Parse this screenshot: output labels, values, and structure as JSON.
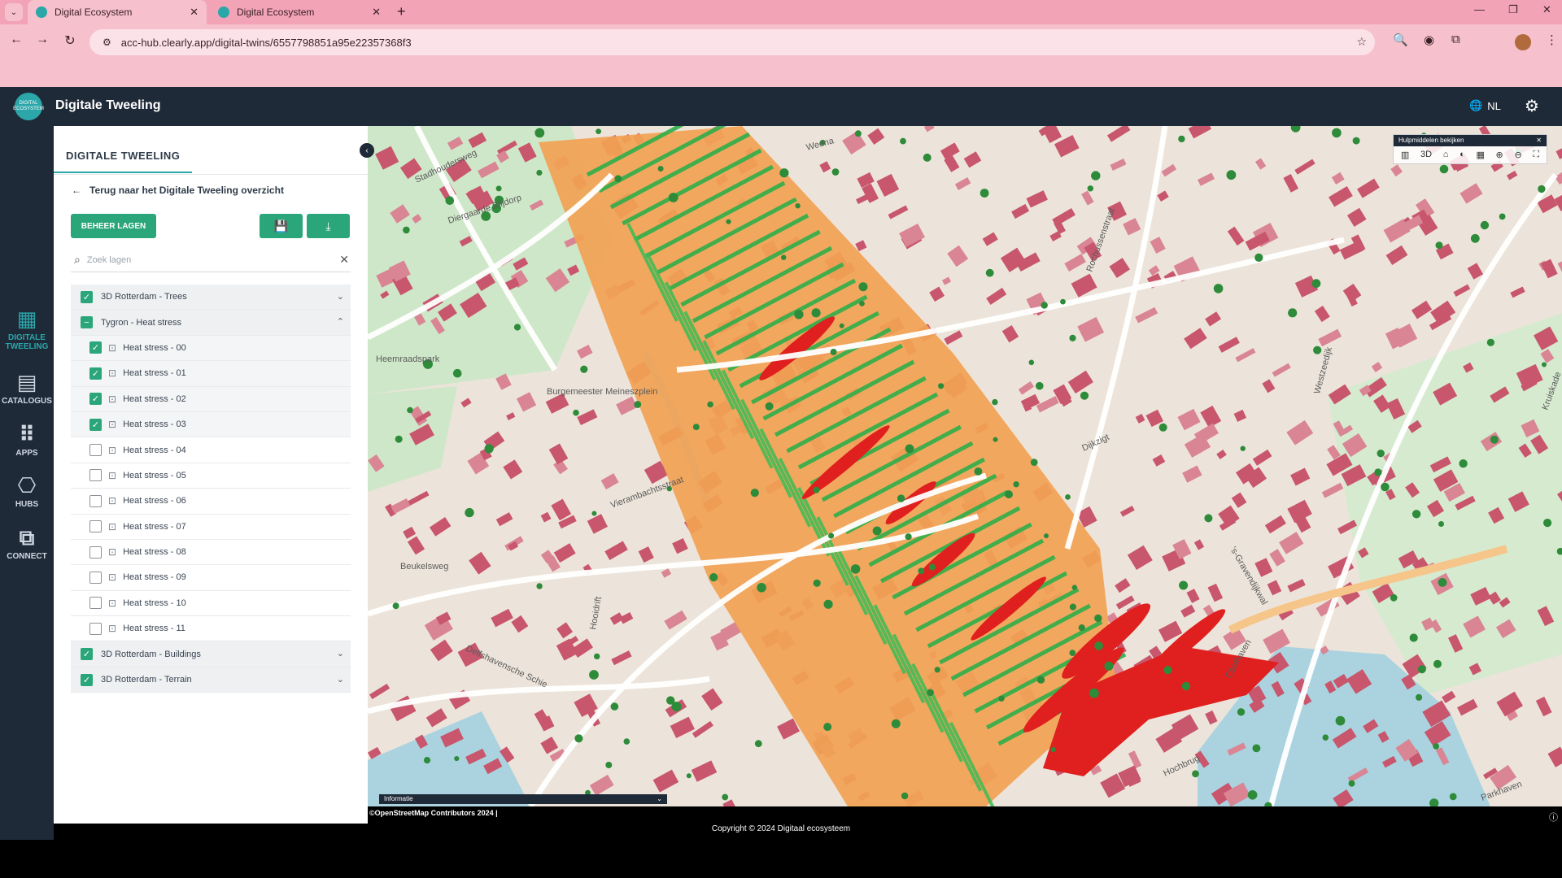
{
  "browser": {
    "tabs": [
      {
        "title": "Digital Ecosystem",
        "active": true
      },
      {
        "title": "Digital Ecosystem",
        "active": false
      }
    ],
    "url": "acc-hub.clearly.app/digital-twins/6557798851a95e22357368f3",
    "new_tab": "+",
    "tab_close": "✕",
    "tab_list": "⌄",
    "back": "←",
    "forward": "→",
    "reload": "↻",
    "site_info": "⚙",
    "zoom": "🔍",
    "star": "☆",
    "minimize": "—",
    "maximize": "❐",
    "close": "✕",
    "more": "⋮"
  },
  "app": {
    "logo_text": "DIGITAL ECOSYSTEM",
    "title": "Digitale Tweeling",
    "language": "NL",
    "globe": "🌐",
    "settings": "⚙"
  },
  "rail": {
    "items": [
      {
        "label1": "DIGITALE",
        "label2": "TWEELING",
        "icon": "▦",
        "active": true
      },
      {
        "label1": "CATALOGUS",
        "label2": "",
        "icon": "▤",
        "active": false
      },
      {
        "label1": "APPS",
        "label2": "",
        "icon": "⠿",
        "active": false
      },
      {
        "label1": "HUBS",
        "label2": "",
        "icon": "⎔",
        "active": false
      },
      {
        "label1": "CONNECT",
        "label2": "",
        "icon": "⧉",
        "active": false
      }
    ]
  },
  "panel": {
    "tab": "DIGITALE TWEELING",
    "back_arrow": "←",
    "back_label": "Terug naar het Digitale Tweeling overzicht",
    "manage_layers": "BEHEER LAGEN",
    "save_icon": "💾",
    "download_icon": "⤓",
    "search_placeholder": "Zoek lagen",
    "search_icon": "⌕",
    "clear_icon": "✕",
    "collapse_icon": "‹",
    "layers": [
      {
        "label": "3D Rotterdam - Trees",
        "kind": "group",
        "state": "on",
        "chevron": "⌄"
      },
      {
        "label": "Tygron - Heat stress",
        "kind": "group",
        "state": "partial",
        "chevron": "⌃"
      },
      {
        "label": "Heat stress - 00",
        "kind": "sub",
        "state": "on"
      },
      {
        "label": "Heat stress - 01",
        "kind": "sub",
        "state": "on"
      },
      {
        "label": "Heat stress - 02",
        "kind": "sub",
        "state": "on"
      },
      {
        "label": "Heat stress - 03",
        "kind": "sub",
        "state": "on"
      },
      {
        "label": "Heat stress - 04",
        "kind": "sub",
        "state": "off"
      },
      {
        "label": "Heat stress - 05",
        "kind": "sub",
        "state": "off"
      },
      {
        "label": "Heat stress - 06",
        "kind": "sub",
        "state": "off"
      },
      {
        "label": "Heat stress - 07",
        "kind": "sub",
        "state": "off"
      },
      {
        "label": "Heat stress - 08",
        "kind": "sub",
        "state": "off"
      },
      {
        "label": "Heat stress - 09",
        "kind": "sub",
        "state": "off"
      },
      {
        "label": "Heat stress - 10",
        "kind": "sub",
        "state": "off"
      },
      {
        "label": "Heat stress - 11",
        "kind": "sub",
        "state": "off"
      },
      {
        "label": "3D Rotterdam - Buildings",
        "kind": "group",
        "state": "on",
        "chevron": "⌄"
      },
      {
        "label": "3D Rotterdam - Terrain",
        "kind": "group",
        "state": "on",
        "chevron": "⌄"
      }
    ]
  },
  "map": {
    "tools_title": "Hulpmiddelen bekijken",
    "tools_close": "✕",
    "tools": [
      "▥",
      "3D",
      "⌂",
      "◐",
      "▦",
      "⊕",
      "⊖",
      "⛶"
    ],
    "labels": [
      "Stadhoudersweg",
      "Diergaarde Blijdorp",
      "Weena",
      "Burgemeester Meineszplein",
      "Vierambachtsstraat",
      "Delfshavensche Schie",
      "'s-Gravendijkwal",
      "Westzeedijk",
      "Rochussenstraat",
      "Hooidrift",
      "Coolhaven",
      "Hochbrug",
      "Parkhaven",
      "Heemraadspark",
      "Dijkzigt",
      "Beukelsweg",
      "Kruiskade"
    ],
    "info_label": "Informatie",
    "info_toggle": "⌄",
    "osm_credit": "©OpenStreetMap Contributors 2024 |",
    "copyright": "Copyright © 2024 Digitaal ecosysteem",
    "copy_icon": "ⓘ"
  }
}
